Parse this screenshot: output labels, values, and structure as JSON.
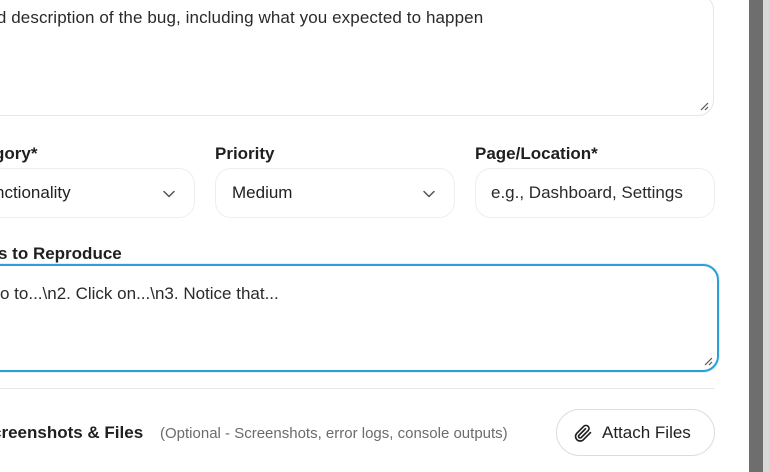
{
  "form": {
    "description": {
      "placeholder": "ailed description of the bug, including what you expected to happen"
    },
    "category": {
      "label": "gory*",
      "value": "nctionality"
    },
    "priority": {
      "label": "Priority",
      "value": "Medium"
    },
    "page_location": {
      "label": "Page/Location*",
      "placeholder": "e.g., Dashboard, Settings"
    },
    "steps": {
      "label": "s to Reproduce",
      "placeholder": "o to...\\n2. Click on...\\n3. Notice that..."
    },
    "attachments": {
      "title": "creenshots & Files",
      "note": "(Optional - Screenshots, error logs, console outputs)",
      "button_label": "Attach Files"
    }
  },
  "icons": {
    "category_chevron": "chevron-down-icon",
    "priority_chevron": "chevron-down-icon",
    "attach_icon": "paperclip-icon"
  },
  "colors": {
    "focus_border": "#2a9fd8",
    "scrollbar": "#6e6e6e"
  }
}
